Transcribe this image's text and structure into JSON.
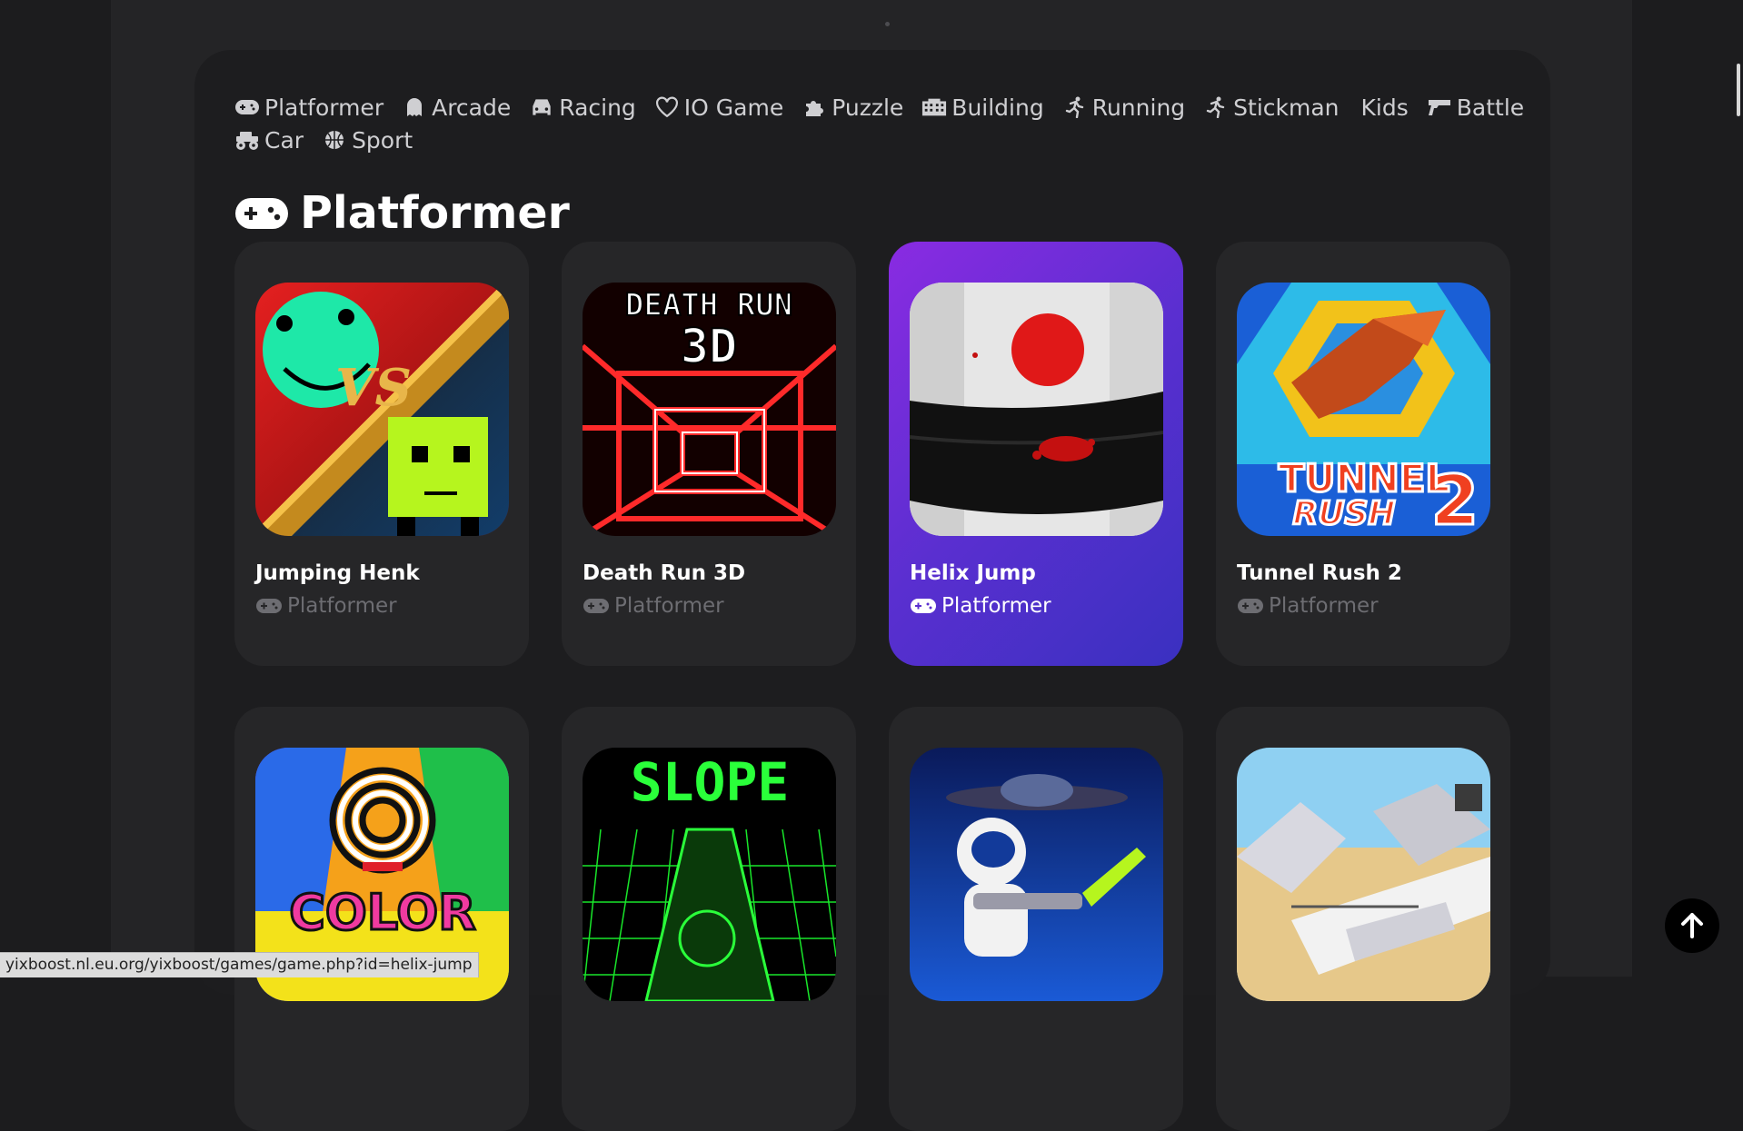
{
  "categories": [
    {
      "label": "Platformer",
      "icon": "gamepad-icon"
    },
    {
      "label": "Arcade",
      "icon": "ghost-icon"
    },
    {
      "label": "Racing",
      "icon": "car-icon"
    },
    {
      "label": "IO Game",
      "icon": "heart-icon"
    },
    {
      "label": "Puzzle",
      "icon": "puzzle-icon"
    },
    {
      "label": "Building",
      "icon": "building-icon"
    },
    {
      "label": "Running",
      "icon": "running-icon"
    },
    {
      "label": "Stickman",
      "icon": "stickman-icon"
    },
    {
      "label": "Kids",
      "icon": ""
    },
    {
      "label": "Battle",
      "icon": "gun-icon"
    },
    {
      "label": "Car",
      "icon": "monster-truck-icon"
    },
    {
      "label": "Sport",
      "icon": "basketball-icon"
    }
  ],
  "section": {
    "title": "Platformer",
    "icon": "gamepad-icon"
  },
  "games": [
    {
      "title": "Jumping Henk",
      "tag": "Platformer"
    },
    {
      "title": "Death Run 3D",
      "tag": "Platformer",
      "thumb_text": [
        "DEATH RUN",
        "3D"
      ]
    },
    {
      "title": "Helix Jump",
      "tag": "Platformer"
    },
    {
      "title": "Tunnel Rush 2",
      "tag": "Platformer",
      "thumb_text": [
        "TUNNEL",
        "RUSH",
        "2"
      ]
    }
  ],
  "games_row2": [
    {
      "thumb_text": "COLOR"
    },
    {
      "thumb_text": "SLOPE"
    },
    {
      "thumb_text": ""
    },
    {
      "thumb_text": ""
    }
  ],
  "status_url": "yixboost.nl.eu.org/yixboost/games/game.php?id=helix-jump",
  "colors": {
    "accent": "#7b2ff0",
    "background": "#1c1c1e",
    "card": "#262628"
  }
}
